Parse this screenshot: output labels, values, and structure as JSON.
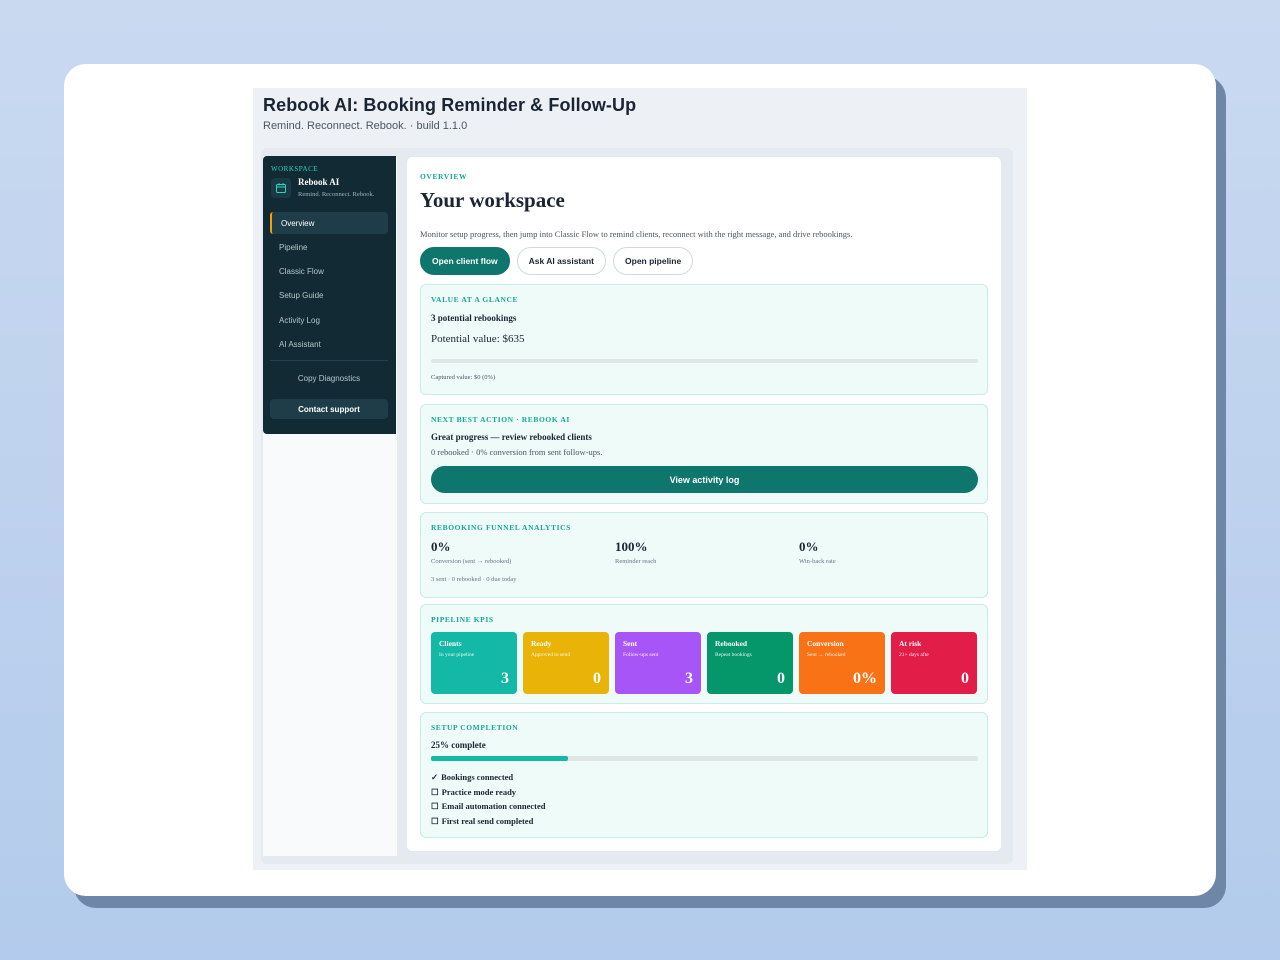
{
  "app": {
    "title": "Rebook AI: Booking Reminder & Follow-Up",
    "subtitle": "Remind. Reconnect. Rebook. · build 1.1.0"
  },
  "sidebar": {
    "workspace_label": "WORKSPACE",
    "workspace_name": "Rebook AI",
    "workspace_tagline": "Remind. Reconnect. Rebook.",
    "items": [
      {
        "label": "Overview",
        "active": true
      },
      {
        "label": "Pipeline"
      },
      {
        "label": "Classic Flow"
      },
      {
        "label": "Setup Guide"
      },
      {
        "label": "Activity Log"
      },
      {
        "label": "AI Assistant"
      }
    ],
    "copy_diagnostics": "Copy Diagnostics",
    "contact_support": "Contact support"
  },
  "main": {
    "eyebrow": "OVERVIEW",
    "title": "Your workspace",
    "description": "Monitor setup progress, then jump into Classic Flow to remind clients, reconnect with the right message, and drive rebookings.",
    "actions": [
      "Open client flow",
      "Ask AI assistant",
      "Open pipeline"
    ]
  },
  "value_card": {
    "eyebrow": "VALUE AT A GLANCE",
    "headline": "3 potential rebookings",
    "potential": "Potential value: $635",
    "captured": "Captured value: $0 (0%)",
    "captured_fraction": 0
  },
  "next_action": {
    "eyebrow": "NEXT BEST ACTION · REBOOK AI",
    "headline": "Great progress — review rebooked clients",
    "detail": "0 rebooked · 0% conversion from sent follow-ups.",
    "button": "View activity log"
  },
  "funnel": {
    "eyebrow": "REBOOKING FUNNEL ANALYTICS",
    "metrics": [
      {
        "value": "0%",
        "label": "Conversion (sent → rebooked)"
      },
      {
        "value": "100%",
        "label": "Reminder reach"
      },
      {
        "value": "0%",
        "label": "Win-back rate"
      }
    ],
    "summary": "3 sent · 0 rebooked · 0 due today"
  },
  "kpis": {
    "eyebrow": "PIPELINE KPIS",
    "items": [
      {
        "name": "Clients",
        "desc": "In your pipeline",
        "value": "3",
        "color": "#14b8a6"
      },
      {
        "name": "Ready",
        "desc": "Approved to send",
        "value": "0",
        "color": "#eab308"
      },
      {
        "name": "Sent",
        "desc": "Follow-ups sent",
        "value": "3",
        "color": "#a855f7"
      },
      {
        "name": "Rebooked",
        "desc": "Repeat bookings",
        "value": "0",
        "color": "#059669"
      },
      {
        "name": "Conversion",
        "desc": "Sent → rebooked",
        "value": "0%",
        "color": "#f97316"
      },
      {
        "name": "At risk",
        "desc": "21+ days afte",
        "value": "0",
        "color": "#e11d48"
      }
    ]
  },
  "setup": {
    "eyebrow": "SETUP COMPLETION",
    "headline": "25% complete",
    "progress_fraction": 0.25,
    "checklist": [
      {
        "mark": "✓",
        "label": "Bookings connected"
      },
      {
        "mark": "☐",
        "label": "Practice mode ready"
      },
      {
        "mark": "☐",
        "label": "Email automation connected"
      },
      {
        "mark": "☐",
        "label": "First real send completed"
      }
    ]
  },
  "colors": {
    "accent": "#0f766e",
    "sidebar_bg": "#112a33",
    "active_marker": "#f59e0b",
    "card_bg": "#effbf9"
  }
}
